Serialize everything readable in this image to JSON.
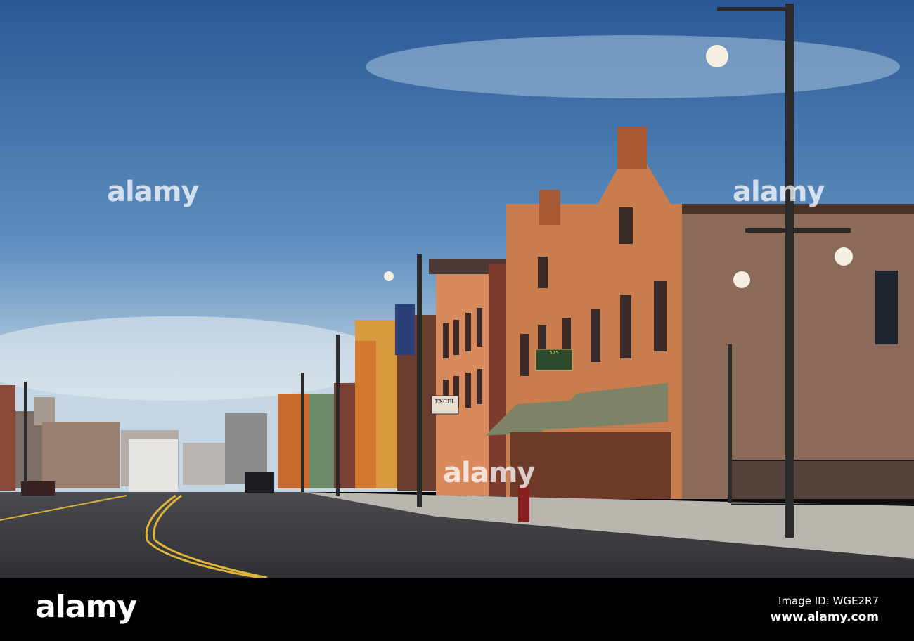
{
  "photo": {
    "signs": {
      "excel": "EXCEL",
      "building_number": "575"
    }
  },
  "watermark": {
    "text": "alamy"
  },
  "footer": {
    "logo": "alamy",
    "image_id": "Image ID: WGE2R7",
    "url": "www.alamy.com"
  },
  "colors": {
    "sky_top": "#2d5d99",
    "sky_bottom": "#cfdde6",
    "brick": "#c8744a",
    "road": "#3a3b3f",
    "footer_bg": "#000000"
  }
}
